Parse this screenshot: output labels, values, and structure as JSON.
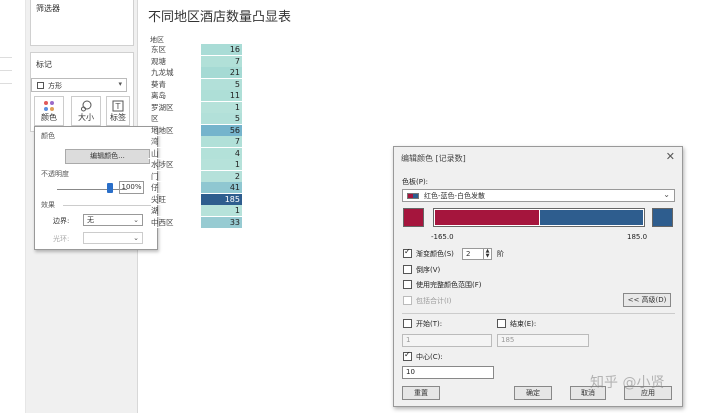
{
  "side_panel": {
    "filters_title": "筛选器",
    "marks_title": "标记",
    "mark_type": "方形",
    "mark_buttons": [
      {
        "label": "颜色",
        "icon": "palette-dots-icon"
      },
      {
        "label": "大小",
        "icon": "size-circles-icon"
      },
      {
        "label": "标签",
        "icon": "text-label-icon"
      }
    ]
  },
  "color_popup": {
    "color_section": "颜色",
    "edit_colors_button": "编辑颜色...",
    "opacity_label": "不透明度",
    "opacity_value": "100%",
    "opacity_fraction": 1.0,
    "effects_label": "效果",
    "border_label": "边界:",
    "border_value": "无",
    "halo_label": "光环:",
    "halo_value": ""
  },
  "viz": {
    "title": "不同地区酒店数量凸显表",
    "column_header": "地区",
    "rows": [
      {
        "region": "东区",
        "value": "16",
        "color": "#a9dcd6"
      },
      {
        "region": "观塘",
        "value": "7",
        "color": "#b1e0d8"
      },
      {
        "region": "九龙城",
        "value": "21",
        "color": "#a5dad4"
      },
      {
        "region": "葵青",
        "value": "5",
        "color": "#b2e0d9"
      },
      {
        "region": "离岛",
        "value": "11",
        "color": "#aedfd7"
      },
      {
        "region": "罗湖区",
        "value": "1",
        "color": "#b6e2da"
      },
      {
        "region": "区",
        "value": "5",
        "color": "#b2e0d9"
      },
      {
        "region": "地地区",
        "value": "56",
        "color": "#75b4cc"
      },
      {
        "region": "湾",
        "value": "7",
        "color": "#b1e0d8"
      },
      {
        "region": "山",
        "value": "4",
        "color": "#b3e1d9"
      },
      {
        "region": "水埗区",
        "value": "1",
        "color": "#b6e2da"
      },
      {
        "region": "门",
        "value": "2",
        "color": "#b5e1da"
      },
      {
        "region": "仔",
        "value": "41",
        "color": "#8fc7d1"
      },
      {
        "region": "尖旺",
        "value": "185",
        "color": "#2e5d8e",
        "text_color": "#ffffff"
      },
      {
        "region": "湖",
        "value": "1",
        "color": "#b6e2da"
      },
      {
        "region": "中西区",
        "value": "33",
        "color": "#97cbd2"
      }
    ]
  },
  "dialog": {
    "title": "编辑颜色 [记录数]",
    "palette_label": "色板(P):",
    "palette_value": "红色-蓝色-白色发散",
    "palette_colors": {
      "low": "#a5153d",
      "high": "#2e5d8e"
    },
    "range_min": "-165.0",
    "range_max": "185.0",
    "stepped_label": "渐变颜色(S)",
    "stepped_value": "2",
    "steps_unit": "阶",
    "reverse_label": "倒序(V)",
    "full_range_label": "使用完整颜色范围(F)",
    "include_totals_label": "包括合计(I)",
    "advanced_button": "<< 高级(D)",
    "start_label": "开始(T):",
    "start_value": "1",
    "end_label": "结束(E):",
    "end_value": "185",
    "center_label": "中心(C):",
    "center_value": "10",
    "reset_button": "重置",
    "ok_button": "确定",
    "cancel_button": "取消",
    "apply_button": "应用"
  },
  "watermark": "知乎 @小贤"
}
